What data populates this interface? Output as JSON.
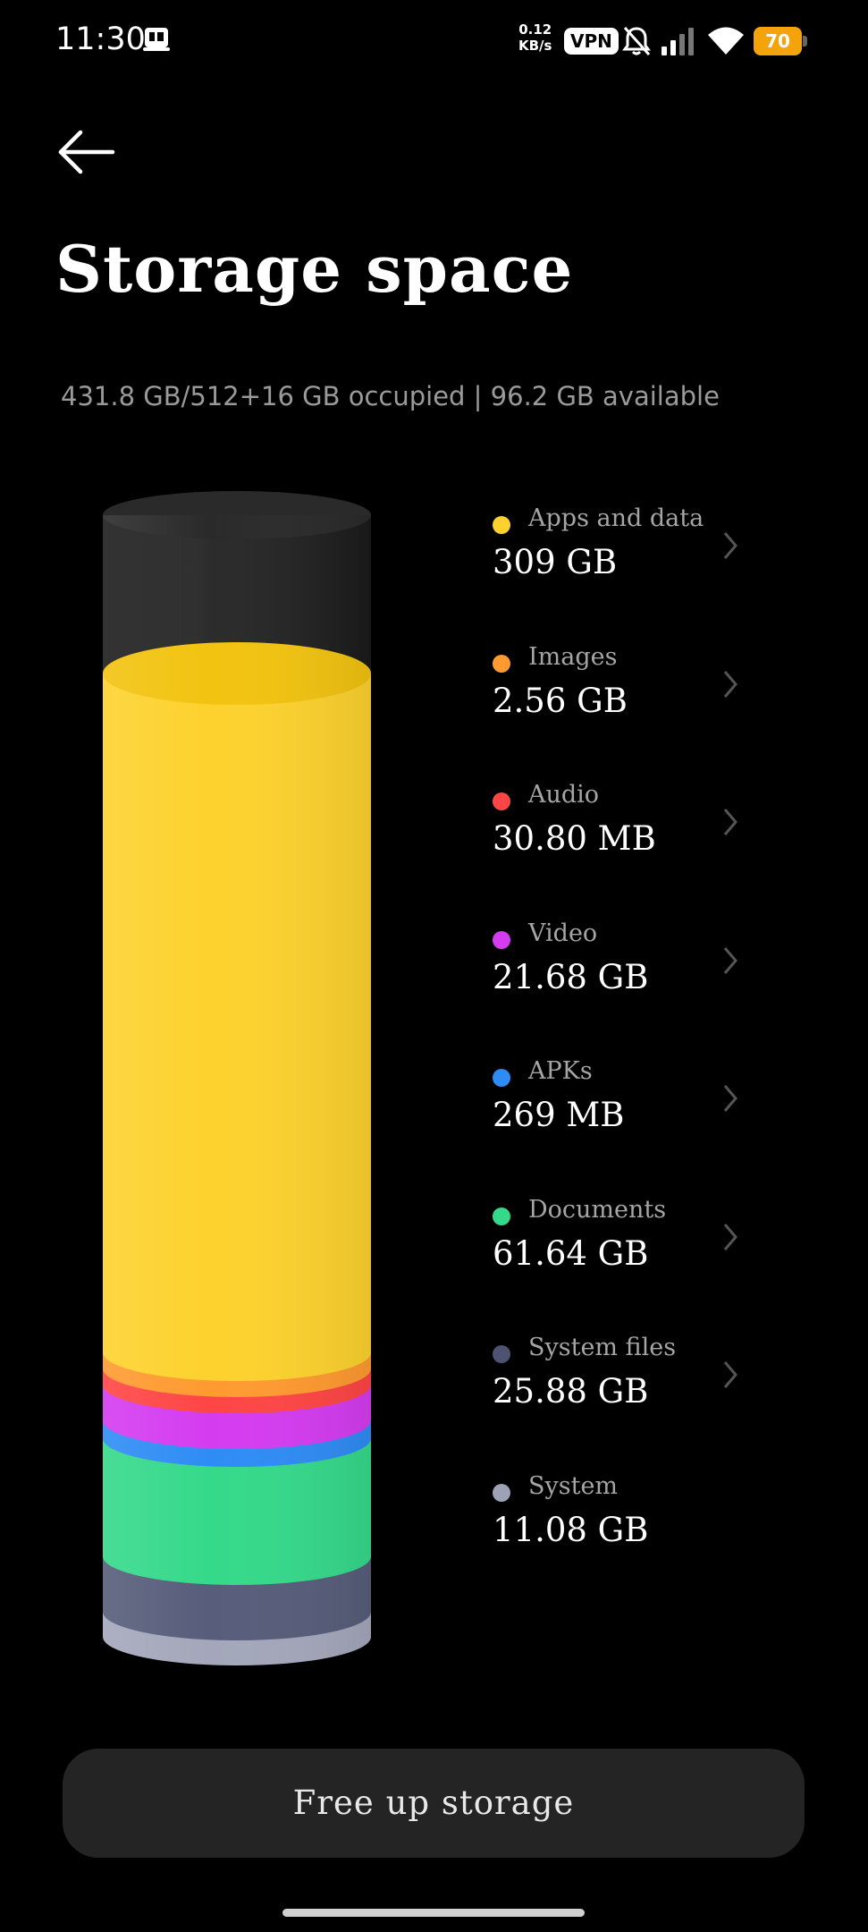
{
  "status_bar": {
    "time": "11:30",
    "net_speed_value": "0.12",
    "net_speed_unit": "KB/s",
    "vpn": "VPN",
    "battery": "70"
  },
  "page": {
    "title": "Storage space",
    "summary": "431.8 GB/512+16 GB occupied | 96.2 GB available"
  },
  "categories": [
    {
      "label": "Apps and data",
      "value": "309 GB",
      "color": "#fdd22e",
      "has_chevron": true
    },
    {
      "label": "Images",
      "value": "2.56 GB",
      "color": "#ff9a30",
      "has_chevron": true
    },
    {
      "label": "Audio",
      "value": "30.80 MB",
      "color": "#ff4545",
      "has_chevron": true
    },
    {
      "label": "Video",
      "value": "21.68 GB",
      "color": "#d43cf0",
      "has_chevron": true
    },
    {
      "label": "APKs",
      "value": "269 MB",
      "color": "#2f8cf5",
      "has_chevron": true
    },
    {
      "label": "Documents",
      "value": "61.64 GB",
      "color": "#35d98a",
      "has_chevron": true
    },
    {
      "label": "System files",
      "value": "25.88 GB",
      "color": "#4d5370",
      "has_chevron": true
    },
    {
      "label": "System",
      "value": "11.08 GB",
      "color": "#9ea2b6",
      "has_chevron": false
    }
  ],
  "actions": {
    "free_up": "Free up storage"
  }
}
